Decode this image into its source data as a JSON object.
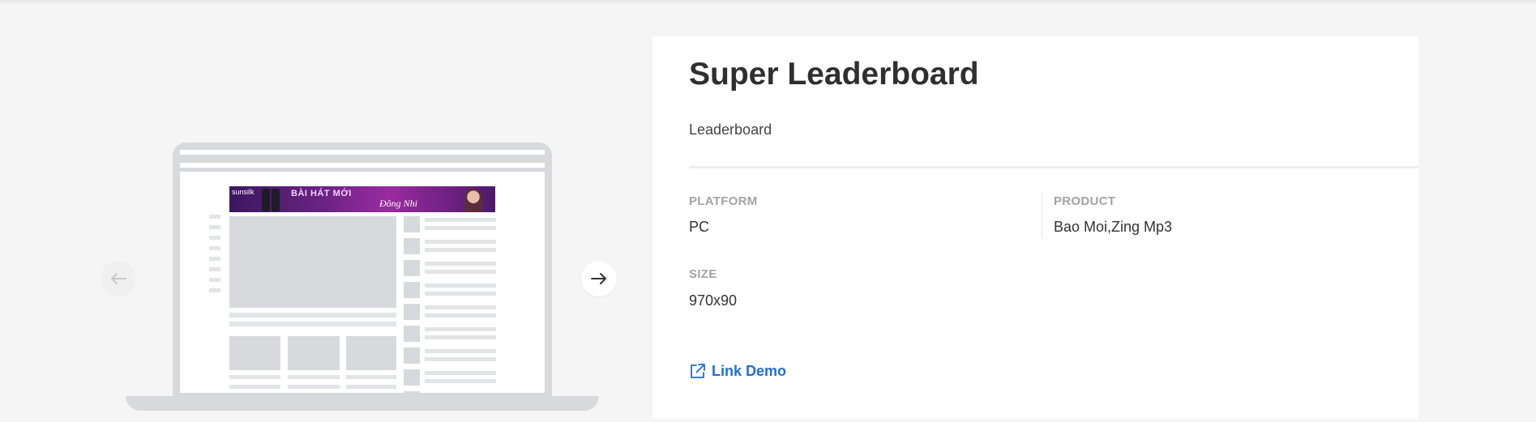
{
  "preview": {
    "ad_brand": "sunsilk",
    "ad_title": "BÀI HÁT MỚI",
    "ad_subtitle": "Đông Nhi",
    "prev_icon": "arrow-left-icon",
    "next_icon": "arrow-right-icon"
  },
  "details": {
    "title": "Super Leaderboard",
    "category": "Leaderboard",
    "platform_label": "PLATFORM",
    "platform_value": "PC",
    "product_label": "PRODUCT",
    "product_value": "Bao Moi,Zing Mp3",
    "size_label": "SIZE",
    "size_value": "970x90",
    "demo_link_label": "Link Demo",
    "demo_link_icon": "external-link-icon",
    "link_color": "#1f6fd6"
  }
}
